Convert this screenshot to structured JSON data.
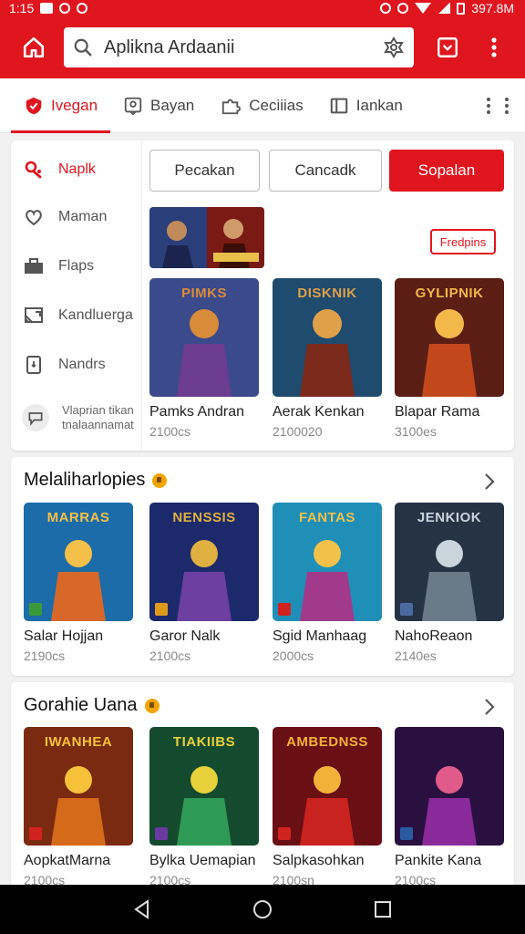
{
  "status_bar": {
    "time": "1:15",
    "right_text": "397.8M"
  },
  "search": {
    "value": "Aplikna Ardaanii"
  },
  "tabs": [
    {
      "label": "Ivegan",
      "icon": "shield-icon",
      "active": true
    },
    {
      "label": "Bayan",
      "icon": "badge-icon",
      "active": false
    },
    {
      "label": "Ceciiias",
      "icon": "puzzle-icon",
      "active": false
    },
    {
      "label": "Iankan",
      "icon": "book-icon",
      "active": false
    }
  ],
  "side_menu": [
    {
      "label": "Naplk",
      "icon": "gamepad-icon",
      "active": true
    },
    {
      "label": "Maman",
      "icon": "heart-icon",
      "active": false
    },
    {
      "label": "Flaps",
      "icon": "briefcase-icon",
      "active": false
    },
    {
      "label": "Kandluerga",
      "icon": "cast-icon",
      "active": false
    },
    {
      "label": "Nandrs",
      "icon": "phone-icon",
      "active": false
    },
    {
      "label": "Vlaprian tikan tnalaannamat",
      "icon": "chat-icon",
      "active": false
    }
  ],
  "filters": [
    {
      "label": "Pecakan",
      "primary": false
    },
    {
      "label": "Cancadk",
      "primary": false
    },
    {
      "label": "Sopalan",
      "primary": true
    }
  ],
  "banner_badge": "Fredpins",
  "section1": {
    "items": [
      {
        "name": "Pamks Andran",
        "count": "2100cs",
        "thumb_title": "PIMKS",
        "colors": [
          "#3a4a8a",
          "#6b3c8f",
          "#d98c3a"
        ]
      },
      {
        "name": "Aerak Kenkan",
        "count": "2100020",
        "thumb_title": "DISKNIK",
        "colors": [
          "#1f4b6e",
          "#7b2a1c",
          "#e0a04a"
        ]
      },
      {
        "name": "Blapar Rama",
        "count": "3100es",
        "thumb_title": "GYLIPNIK",
        "colors": [
          "#5a1e14",
          "#c2481c",
          "#f2b84a"
        ]
      }
    ]
  },
  "section2": {
    "title": "Melaliharlopies",
    "items": [
      {
        "name": "Salar Hojjan",
        "count": "2190cs",
        "thumb_title": "MARRAS",
        "colors": [
          "#1b6ca8",
          "#d7682a",
          "#f4c04a"
        ]
      },
      {
        "name": "Garor Nalk",
        "count": "2100cs",
        "thumb_title": "NENSSIS",
        "colors": [
          "#1c2a6b",
          "#6c3fa0",
          "#e0b040"
        ]
      },
      {
        "name": "Sgid Manhaag",
        "count": "2000cs",
        "thumb_title": "FANTAS",
        "colors": [
          "#1f8fb8",
          "#a23a8c",
          "#f2c14a"
        ]
      },
      {
        "name": "NahoReaon",
        "count": "2140es",
        "thumb_title": "JENKIOK",
        "colors": [
          "#253344",
          "#6a7a88",
          "#c9d4dc"
        ]
      }
    ]
  },
  "section3": {
    "title": "Gorahie Uana",
    "items": [
      {
        "name": "AopkatMarna",
        "count": "2100cs",
        "thumb_title": "IWANHEA",
        "colors": [
          "#7a2a10",
          "#d46a1a",
          "#f7c23a"
        ]
      },
      {
        "name": "Bylka Uemapian",
        "count": "2100cs",
        "thumb_title": "TIAKIIBS",
        "colors": [
          "#144a2e",
          "#2f9a55",
          "#e6d13a"
        ]
      },
      {
        "name": "Salpkasohkan",
        "count": "2100sn",
        "thumb_title": "AMBEDNSS",
        "colors": [
          "#6a0f14",
          "#c8231f",
          "#f2b23a"
        ]
      },
      {
        "name": "Pankite Kana",
        "count": "2100cs",
        "thumb_title": "",
        "colors": [
          "#2a1040",
          "#8a2a9a",
          "#e05a8a"
        ]
      }
    ]
  },
  "colors": {
    "accent": "#e0161f",
    "coin": "#f2a500"
  }
}
